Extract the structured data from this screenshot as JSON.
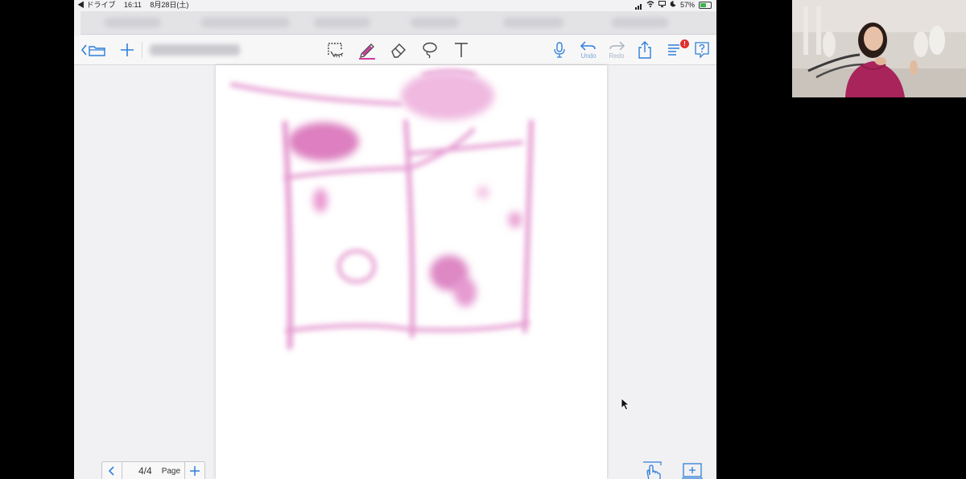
{
  "status_bar": {
    "back_app": "◀ ドライブ",
    "time": "16:11",
    "date": "8月28日(土)",
    "battery": "57%"
  },
  "toolbar": {
    "undo_label": "Undo",
    "redo_label": "Redo",
    "notification_badge": "!"
  },
  "page_nav": {
    "current": "4/4",
    "page_label": "Page"
  },
  "icons": {
    "back": "chevron-left-icon",
    "folder": "folder-icon",
    "add": "plus-icon",
    "read_mode": "read-mode-icon",
    "pen": "pen-icon",
    "eraser": "eraser-icon",
    "lasso": "lasso-icon",
    "text": "text-tool-icon",
    "mic": "microphone-icon",
    "share": "share-icon",
    "menu": "menu-icon",
    "help": "help-icon",
    "hand": "hand-pointer-icon",
    "zoom": "zoom-window-icon"
  },
  "colors": {
    "accent": "#2f7fd8",
    "pen": "#d23a9f",
    "sketch": "#e59ad0"
  }
}
